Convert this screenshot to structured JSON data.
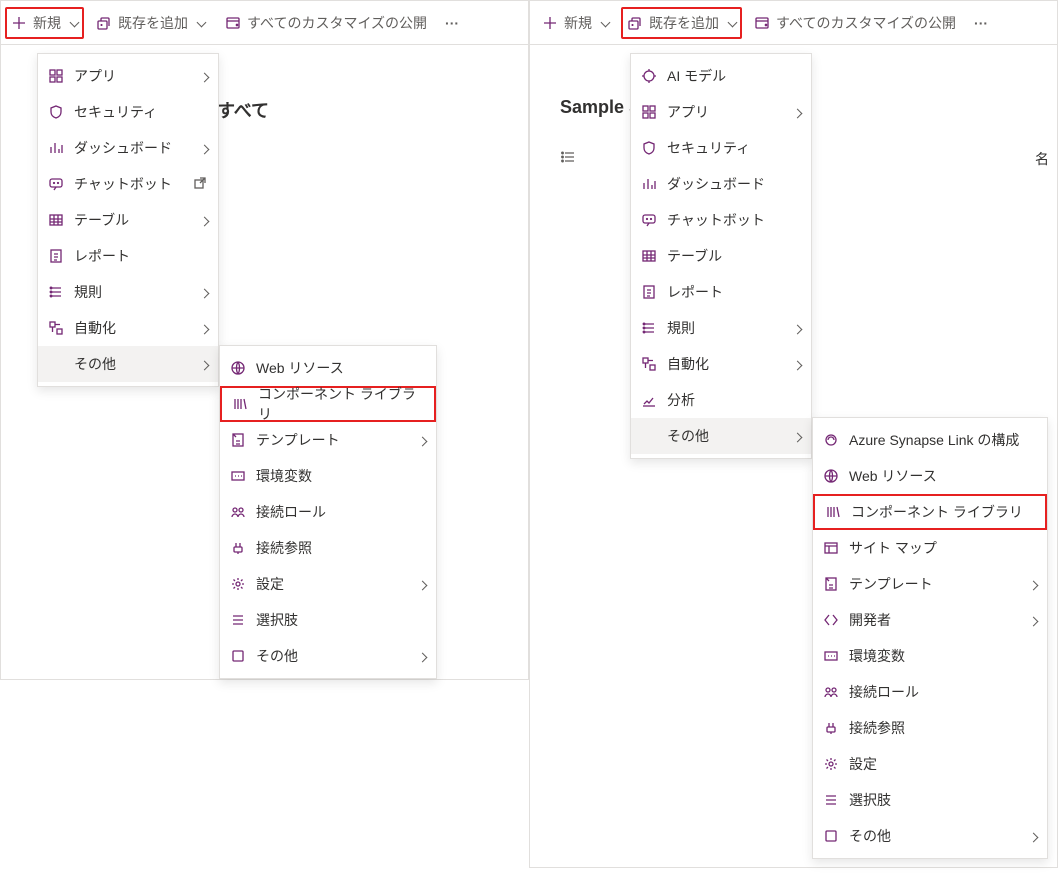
{
  "left": {
    "toolbar": {
      "new": "新規",
      "add_existing": "既存を追加",
      "publish_all": "すべてのカスタマイズの公開"
    },
    "bg_label": "すべて",
    "menu1": {
      "items": [
        {
          "id": "app",
          "label": "アプリ",
          "icon": "app-icon",
          "arrow": true
        },
        {
          "id": "security",
          "label": "セキュリティ",
          "icon": "shield-icon",
          "arrow": false
        },
        {
          "id": "dashboard",
          "label": "ダッシュボード",
          "icon": "dashboard-icon",
          "arrow": true
        },
        {
          "id": "chatbot",
          "label": "チャットボット",
          "icon": "chatbot-icon",
          "arrow": false,
          "ext": true
        },
        {
          "id": "table",
          "label": "テーブル",
          "icon": "table-icon",
          "arrow": true
        },
        {
          "id": "report",
          "label": "レポート",
          "icon": "report-icon",
          "arrow": false
        },
        {
          "id": "rule",
          "label": "規則",
          "icon": "rule-icon",
          "arrow": true
        },
        {
          "id": "auto",
          "label": "自動化",
          "icon": "automation-icon",
          "arrow": true
        },
        {
          "id": "other",
          "label": "その他",
          "icon": "",
          "arrow": true,
          "hovered": true
        }
      ]
    },
    "submenu": {
      "items": [
        {
          "id": "webres",
          "label": "Web リソース",
          "icon": "web-icon",
          "arrow": false
        },
        {
          "id": "complib",
          "label": "コンポーネント ライブラリ",
          "icon": "library-icon",
          "arrow": false,
          "highlight": true
        },
        {
          "id": "template",
          "label": "テンプレート",
          "icon": "template-icon",
          "arrow": true
        },
        {
          "id": "envvar",
          "label": "環境変数",
          "icon": "envvar-icon",
          "arrow": false
        },
        {
          "id": "connrole",
          "label": "接続ロール",
          "icon": "connrole-icon",
          "arrow": false
        },
        {
          "id": "connref",
          "label": "接続参照",
          "icon": "connref-icon",
          "arrow": false
        },
        {
          "id": "setting",
          "label": "設定",
          "icon": "setting-icon",
          "arrow": true
        },
        {
          "id": "choice",
          "label": "選択肢",
          "icon": "choice-icon",
          "arrow": false
        },
        {
          "id": "other",
          "label": "その他",
          "icon": "other-icon",
          "arrow": true
        }
      ]
    }
  },
  "right": {
    "toolbar": {
      "new": "新規",
      "add_existing": "既存を追加",
      "publish_all": "すべてのカスタマイズの公開"
    },
    "bg_label_left": "Sample S",
    "tabs": {
      "icon": "list-icon"
    },
    "col_name": "名",
    "menu1": {
      "items": [
        {
          "id": "aimodel",
          "label": "AI モデル",
          "icon": "ai-icon",
          "arrow": false
        },
        {
          "id": "app",
          "label": "アプリ",
          "icon": "app-icon",
          "arrow": true
        },
        {
          "id": "security",
          "label": "セキュリティ",
          "icon": "shield-icon",
          "arrow": false
        },
        {
          "id": "dashboard",
          "label": "ダッシュボード",
          "icon": "dashboard-icon",
          "arrow": false
        },
        {
          "id": "chatbot",
          "label": "チャットボット",
          "icon": "chatbot-icon",
          "arrow": false
        },
        {
          "id": "table",
          "label": "テーブル",
          "icon": "table-icon",
          "arrow": false
        },
        {
          "id": "report",
          "label": "レポート",
          "icon": "report-icon",
          "arrow": false
        },
        {
          "id": "rule",
          "label": "規則",
          "icon": "rule-icon",
          "arrow": true
        },
        {
          "id": "auto",
          "label": "自動化",
          "icon": "automation-icon",
          "arrow": true
        },
        {
          "id": "analytics",
          "label": "分析",
          "icon": "analytics-icon",
          "arrow": false
        },
        {
          "id": "other",
          "label": "その他",
          "icon": "",
          "arrow": true,
          "hovered": true
        }
      ]
    },
    "submenu": {
      "items": [
        {
          "id": "synapse",
          "label": "Azure Synapse Link の構成",
          "icon": "synapse-icon",
          "arrow": false
        },
        {
          "id": "webres",
          "label": "Web リソース",
          "icon": "web-icon",
          "arrow": false
        },
        {
          "id": "complib",
          "label": "コンポーネント ライブラリ",
          "icon": "library-icon",
          "arrow": false,
          "highlight": true
        },
        {
          "id": "sitemap",
          "label": "サイト マップ",
          "icon": "sitemap-icon",
          "arrow": false
        },
        {
          "id": "template",
          "label": "テンプレート",
          "icon": "template-icon",
          "arrow": true
        },
        {
          "id": "dev",
          "label": "開発者",
          "icon": "dev-icon",
          "arrow": true
        },
        {
          "id": "envvar",
          "label": "環境変数",
          "icon": "envvar-icon",
          "arrow": false
        },
        {
          "id": "connrole",
          "label": "接続ロール",
          "icon": "connrole-icon",
          "arrow": false
        },
        {
          "id": "connref",
          "label": "接続参照",
          "icon": "connref-icon",
          "arrow": false
        },
        {
          "id": "setting",
          "label": "設定",
          "icon": "setting-icon",
          "arrow": false
        },
        {
          "id": "choice",
          "label": "選択肢",
          "icon": "choice-icon",
          "arrow": false
        },
        {
          "id": "other",
          "label": "その他",
          "icon": "other-icon",
          "arrow": true
        }
      ]
    }
  },
  "icons": {
    "plus-icon": "<svg viewBox='0 0 16 16'><path d='M8 2v12M2 8h12'/></svg>",
    "add-existing-icon": "<svg viewBox='0 0 16 16'><rect x='2' y='6' width='9' height='8' rx='1'/><path d='M5 6V4a1 1 0 0 1 1-1h6a1 1 0 0 1 1 1v7'/><path d='M6.5 10h-2M5.5 9v2' stroke='#742774'/></svg>",
    "publish-icon": "<svg viewBox='0 0 16 16'><rect x='2' y='3' width='12' height='10' rx='1'/><path d='M2 6h12'/><path d='M11 9l2 2M13 9l-2 2' stroke='#742774'/></svg>",
    "app-icon": "<svg viewBox='0 0 16 16'><rect x='2' y='2' width='5' height='5'/><rect x='9' y='2' width='5' height='5'/><rect x='2' y='9' width='5' height='5'/><rect x='9' y='9' width='5' height='5'/></svg>",
    "shield-icon": "<svg viewBox='0 0 16 16'><path d='M8 2l5 2v4c0 3-2 5-5 6-3-1-5-3-5-6V4l5-2z'/></svg>",
    "dashboard-icon": "<svg viewBox='0 0 16 16'><path d='M3 13V7M7 13V3M11 13V9M14 13V5'/></svg>",
    "chatbot-icon": "<svg viewBox='0 0 16 16'><rect x='2' y='3' width='12' height='8' rx='2'/><path d='M6 14l2-3'/><circle cx='6' cy='7' r='0.5'/><circle cx='10' cy='7' r='0.5'/></svg>",
    "table-icon": "<svg viewBox='0 0 16 16'><rect x='2' y='3' width='12' height='10'/><path d='M2 7h12M2 10h12M6 3v10M10 3v10'/></svg>",
    "report-icon": "<svg viewBox='0 0 16 16'><rect x='3' y='2' width='10' height='12'/><path d='M6 6h4M6 9h4M6 12h3'/></svg>",
    "rule-icon": "<svg viewBox='0 0 16 16'><path d='M3 4h10M3 8h10M3 12h10'/><circle cx='3' cy='4' r='0.8' fill='currentColor'/><circle cx='3' cy='8' r='0.8' fill='currentColor'/><circle cx='3' cy='12' r='0.8' fill='currentColor'/></svg>",
    "automation-icon": "<svg viewBox='0 0 16 16'><rect x='2' y='2' width='5' height='5'/><rect x='9' y='9' width='5' height='5'/><path d='M7 4.5h5M4.5 7v5'/></svg>",
    "web-icon": "<svg viewBox='0 0 16 16'><circle cx='8' cy='8' r='6'/><path d='M2 8h12M8 2c2 3 2 9 0 12M8 2c-2 3-2 9 0 12'/></svg>",
    "library-icon": "<svg viewBox='0 0 16 16'><path d='M3 3v10M6 3v10M9 3v10M12 3l2 10'/></svg>",
    "template-icon": "<svg viewBox='0 0 16 16'><rect x='3' y='2' width='10' height='12'/><path d='M3 2l3 3'/><path d='M6 9h4M6 12h4'/></svg>",
    "envvar-icon": "<svg viewBox='0 0 16 16'><rect x='2' y='4' width='12' height='8'/><path d='M5 8h1M8 8h1M11 8h1'/></svg>",
    "connrole-icon": "<svg viewBox='0 0 16 16'><circle cx='5' cy='6' r='2'/><circle cx='11' cy='6' r='2'/><path d='M2 13c0-2 2-3 3-3s3 1 3 3M8 13c0-2 2-3 3-3s3 1 3 3'/></svg>",
    "connref-icon": "<svg viewBox='0 0 16 16'><path d='M6 3v4M10 3v4'/><rect x='4' y='7' width='8' height='5' rx='1'/><path d='M8 12v2'/></svg>",
    "setting-icon": "<svg viewBox='0 0 16 16'><circle cx='8' cy='8' r='2'/><path d='M8 2v2M8 12v2M2 8h2M12 8h2M3.5 3.5l1.5 1.5M11 11l1.5 1.5M12.5 3.5L11 5M5 11l-1.5 1.5'/></svg>",
    "choice-icon": "<svg viewBox='0 0 16 16'><path d='M3 4h10M3 8h10M3 12h10'/></svg>",
    "other-icon": "<svg viewBox='0 0 16 16'><rect x='3' y='3' width='10' height='10' rx='1'/></svg>",
    "ai-icon": "<svg viewBox='0 0 16 16'><circle cx='8' cy='8' r='5'/><path d='M8 3V1M8 15v-2M3 8H1M15 8h-2'/></svg>",
    "analytics-icon": "<svg viewBox='0 0 16 16'><path d='M3 12l3-3 2 2 4-5'/><path d='M2 14h12'/></svg>",
    "synapse-icon": "<svg viewBox='0 0 16 16'><circle cx='8' cy='8' r='5'/><path d='M5 8a3 3 0 0 1 6 0'/></svg>",
    "sitemap-icon": "<svg viewBox='0 0 16 16'><rect x='2' y='3' width='12' height='10'/><path d='M2 6h12M6 6v7'/></svg>",
    "dev-icon": "<svg viewBox='0 0 16 16'><path d='M6 3l-4 5 4 5M10 3l4 5-4 5'/></svg>",
    "list-icon": "<svg viewBox='0 0 16 16'><path d='M5 4h9M5 8h9M5 12h9'/><circle cx='2.5' cy='4' r='0.8' fill='currentColor'/><circle cx='2.5' cy='8' r='0.8' fill='currentColor'/><circle cx='2.5' cy='12' r='0.8' fill='currentColor'/></svg>",
    "open-ext-icon": "<svg viewBox='0 0 16 16'><rect x='3' y='5' width='8' height='8'/><path d='M8 3h5v5M13 3l-5 5'/></svg>"
  }
}
